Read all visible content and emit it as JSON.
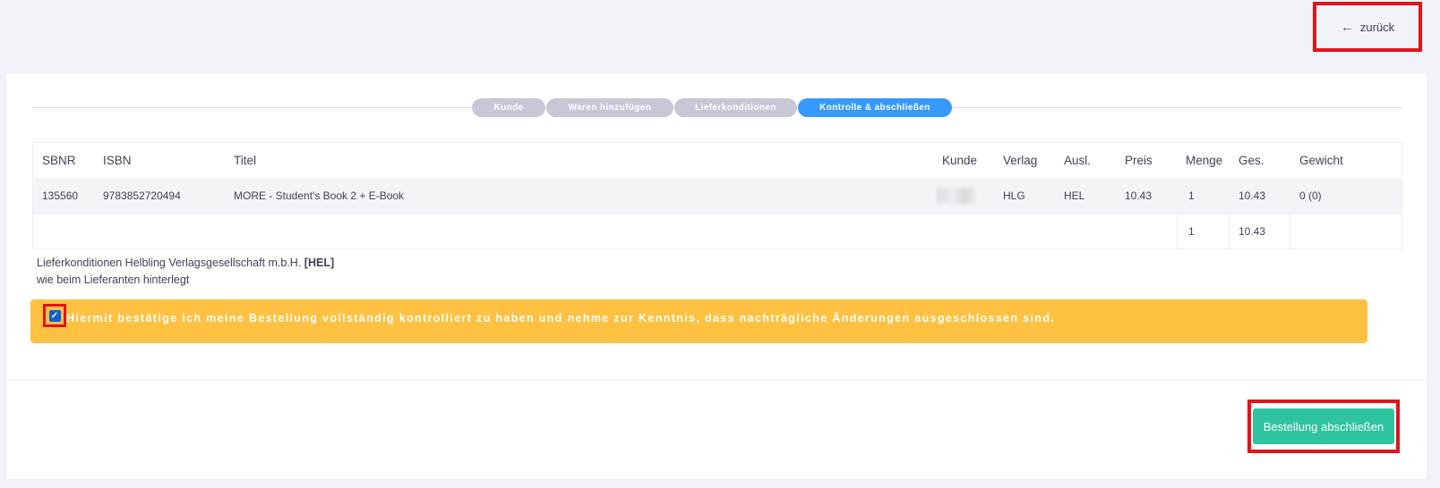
{
  "header": {
    "back_label": "zurück",
    "back_icon": "arrow-left-icon"
  },
  "steps": [
    {
      "label": "Kunde",
      "active": false
    },
    {
      "label": "Waren hinzufügen",
      "active": false
    },
    {
      "label": "Lieferkonditionen",
      "active": false
    },
    {
      "label": "Kontrolle & abschließen",
      "active": true
    }
  ],
  "table": {
    "columns": [
      "SBNR",
      "ISBN",
      "Titel",
      "Kunde",
      "Verlag",
      "Ausl.",
      "Preis",
      "Menge",
      "Ges.",
      "Gewicht"
    ],
    "rows": [
      {
        "sbnr": "135560",
        "isbn": "9783852720494",
        "titel": "MORE - Student's Book 2 + E-Book",
        "kunde": "",
        "verlag": "HLG",
        "ausl": "HEL",
        "preis": "10.43",
        "menge": "1",
        "ges": "10.43",
        "gewicht": "0 (0)"
      }
    ],
    "totals": {
      "menge": "1",
      "ges": "10.43"
    }
  },
  "conditions": {
    "prefix": "Lieferkonditionen Helbling Verlagsgesellschaft m.b.H.",
    "code": "[HEL]",
    "note": "wie beim Lieferanten hinterlegt"
  },
  "confirmation": {
    "checked": true,
    "text": "Hiermit bestätige ich meine Bestellung vollständig kontrolliert zu haben und nehme zur Kenntnis, dass nachträgliche Änderungen ausgeschlossen sind."
  },
  "footer": {
    "finish_label": "Bestellung abschließen"
  },
  "colors": {
    "accent": "#3699ff",
    "warning": "#ffc141",
    "success": "#2ec4a0",
    "highlight": "#e4121b"
  }
}
